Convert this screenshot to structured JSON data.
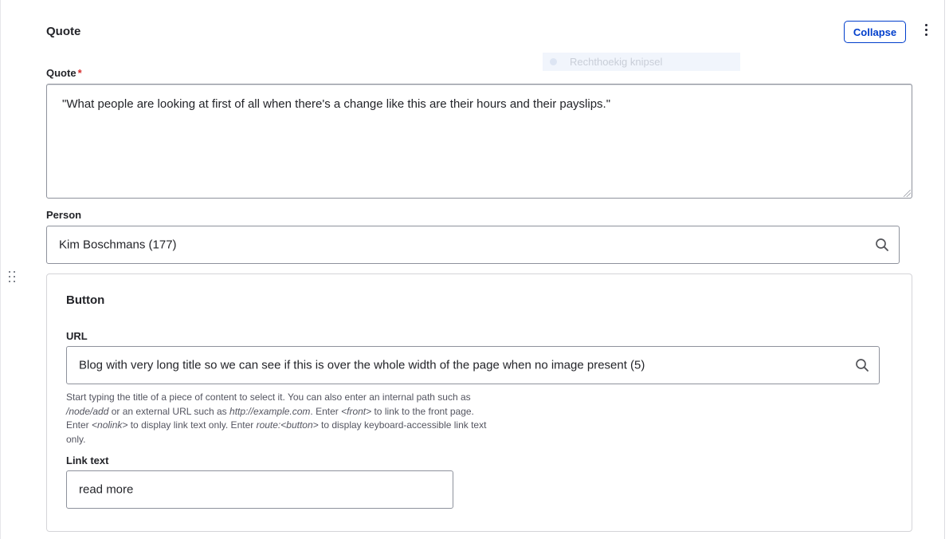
{
  "section": {
    "title": "Quote",
    "collapse_label": "Collapse"
  },
  "snip_overlay": {
    "label": "Rechthoekig knipsel"
  },
  "quote_field": {
    "label": "Quote",
    "required_mark": "*",
    "value": "\"What people are looking at first of all when there's a change like this are their hours and their payslips.\""
  },
  "person_field": {
    "label": "Person",
    "value": "Kim Boschmans (177)"
  },
  "button_panel": {
    "title": "Button",
    "url_field": {
      "label": "URL",
      "value": "Blog with very long title so we can see if this is over the whole width of the page when no image present (5)",
      "description": {
        "t1": "Start typing the title of a piece of content to select it. You can also enter an internal path such as ",
        "path_example": "/node/add",
        "t2": " or an external URL such as ",
        "url_example": "http://example.com",
        "t3": ". Enter ",
        "front_tag": "<front>",
        "t4": " to link to the front page. Enter ",
        "nolink_tag": "<nolink>",
        "t5": " to display link text only. Enter ",
        "route_tag": "route:<button>",
        "t6": " to display keyboard-accessible link text only."
      }
    },
    "link_text_field": {
      "label": "Link text",
      "value": "read more"
    }
  },
  "icons": {
    "search": "search-icon",
    "menu": "kebab-menu-icon",
    "drag": "drag-handle-icon"
  },
  "colors": {
    "accent": "#003ecc",
    "required": "#d62b2b",
    "border": "#8e929c"
  }
}
